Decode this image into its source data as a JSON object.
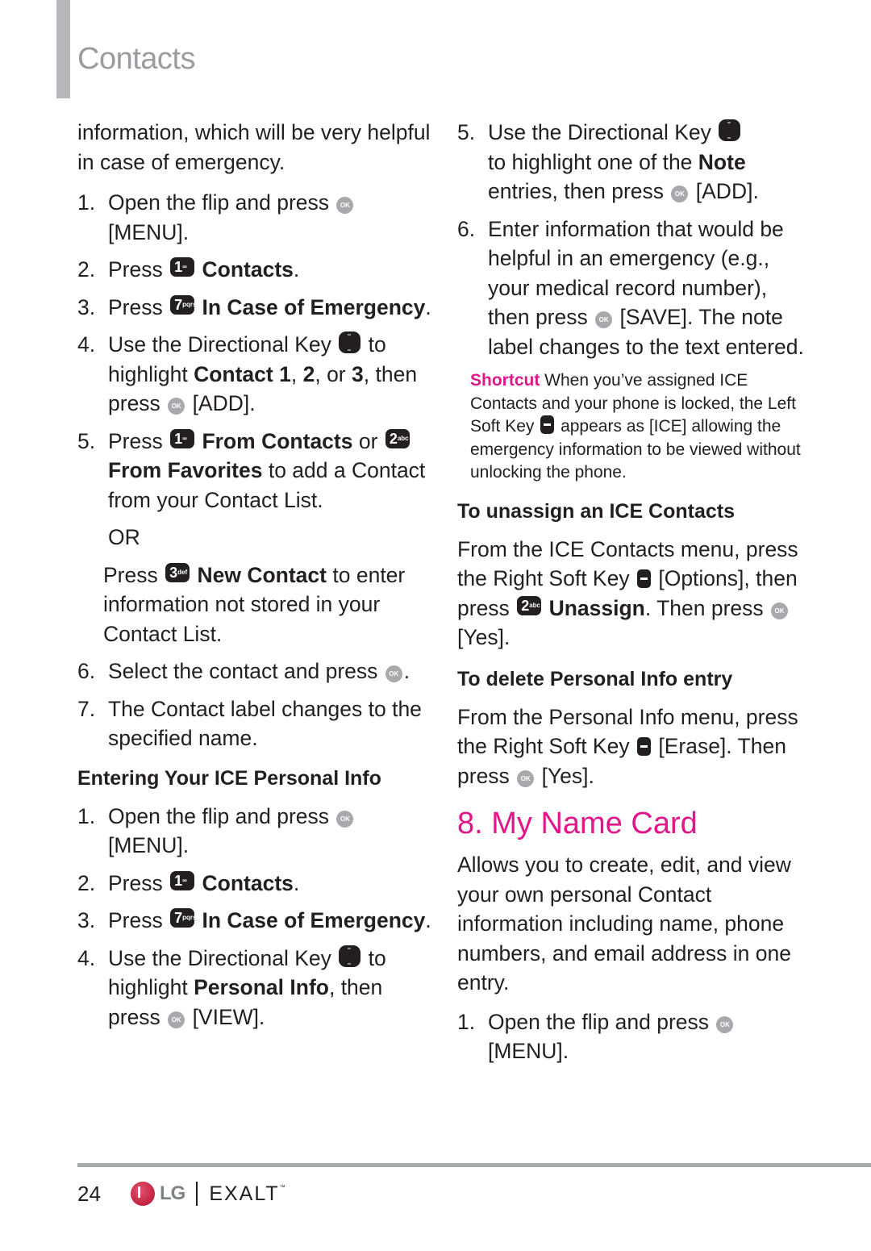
{
  "header": {
    "title": "Contacts"
  },
  "left": {
    "intro": "information, which will be very helpful in case of emergency.",
    "steps_a": [
      {
        "num": "1.",
        "pre": "Open the flip and press",
        "post": "[MENU]."
      },
      {
        "num": "2.",
        "pre": "Press",
        "bold": "Contacts",
        "post": "."
      },
      {
        "num": "3.",
        "pre": "Press",
        "bold": "In Case of Emergency",
        "post": "."
      },
      {
        "num": "4.",
        "pre": "Use the Directional Key",
        "mid1": "to highlight",
        "bold": "Contact 1",
        "sep1": ",",
        "bold2": "2",
        "sep2": ", or",
        "bold3": "3",
        "sep3": ", then press",
        "post": "[ADD]."
      },
      {
        "num": "5.",
        "pre": "Press",
        "bold": "From Contacts",
        "mid": "or",
        "bold2": "From Favorites",
        "post": "to add a Contact from your Contact List."
      }
    ],
    "or_label": "OR",
    "alt": {
      "pre": "Press",
      "bold": "New Contact",
      "post": "to enter information not stored in your Contact List."
    },
    "steps_b": [
      {
        "num": "6.",
        "pre": "Select the contact and press",
        "post": "."
      },
      {
        "num": "7.",
        "pre": "The Contact label changes to the specified name."
      }
    ],
    "heading": "Entering Your ICE Personal Info",
    "steps_c": [
      {
        "num": "1.",
        "pre": "Open the flip and press",
        "post": "[MENU]."
      },
      {
        "num": "2.",
        "pre": "Press",
        "bold": "Contacts",
        "post": "."
      },
      {
        "num": "3.",
        "pre": "Press",
        "bold": "In Case of Emergency",
        "post": "."
      },
      {
        "num": "4.",
        "pre": "Use the Directional Key",
        "mid": "to highlight",
        "bold": "Personal Info",
        "mid2": ", then press",
        "post": "[VIEW]."
      }
    ]
  },
  "right": {
    "steps": [
      {
        "num": "5.",
        "pre": "Use the Directional Key",
        "mid": "to highlight one of the",
        "bold": "Note",
        "mid2": "entries, then press",
        "post": "[ADD]."
      },
      {
        "num": "6.",
        "pre": "Enter information that would be helpful in an emergency (e.g., your medical record number), then press",
        "post": "[SAVE]. The note label changes to the text entered."
      }
    ],
    "shortcut": {
      "label": "Shortcut",
      "pre": "When you’ve assigned ICE Contacts and your phone is locked, the Left Soft Key",
      "post": "appears as [ICE] allowing the emergency information to be viewed without unlocking the phone."
    },
    "unassign": {
      "heading": "To unassign an ICE Contacts",
      "pre": "From the ICE Contacts menu, press the Right Soft Key",
      "mid": "[Options], then press",
      "bold": "Unassign",
      "mid2": ". Then press",
      "post": "[Yes]."
    },
    "delete": {
      "heading": "To delete Personal Info entry",
      "pre": "From the Personal Info menu, press the Right Soft Key",
      "mid": "[Erase]. Then press",
      "post": "[Yes]."
    },
    "section": {
      "title": "8. My Name Card",
      "desc": "Allows you to create, edit, and view your own personal Contact information including name, phone numbers, and email address in one entry.",
      "step": {
        "num": "1.",
        "pre": "Open the flip and press",
        "post": "[MENU]."
      }
    }
  },
  "icons": {
    "ok": "OK",
    "key1": {
      "digit": "1",
      "letters": "∞"
    },
    "key2": {
      "digit": "2",
      "letters": "abc"
    },
    "key3": {
      "digit": "3",
      "letters": "def"
    },
    "key7": {
      "digit": "7",
      "letters": "pqrs"
    }
  },
  "footer": {
    "page_number": "24",
    "brand": "LG",
    "product": "EXALT",
    "trademark": "™"
  },
  "colors": {
    "accent": "#e0168a",
    "title_gray": "#9a9c9f",
    "rule_gray": "#a6aaab"
  }
}
